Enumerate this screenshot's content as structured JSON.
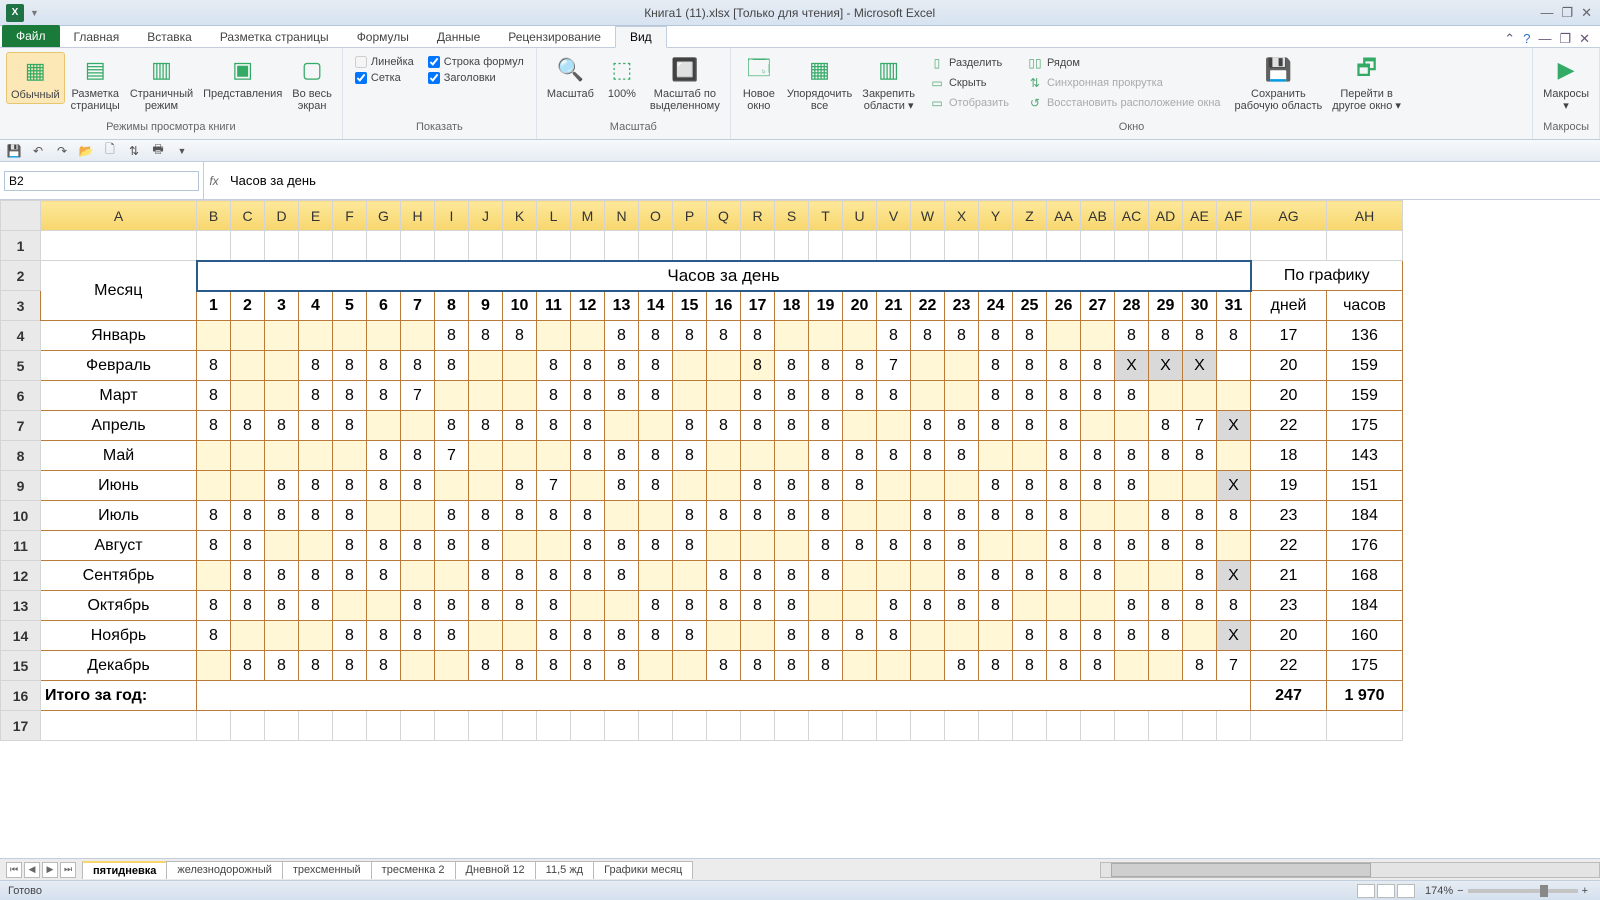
{
  "title": "Книга1 (11).xlsx  [Только для чтения]  -  Microsoft Excel",
  "tabs": {
    "file": "Файл",
    "items": [
      "Главная",
      "Вставка",
      "Разметка страницы",
      "Формулы",
      "Данные",
      "Рецензирование",
      "Вид"
    ],
    "active": "Вид"
  },
  "ribbon": {
    "group_views": {
      "label": "Режимы просмотра книги",
      "normal": "Обычный",
      "page_layout": "Разметка\nстраницы",
      "page_break": "Страничный\nрежим",
      "custom_views": "Представления",
      "full_screen": "Во весь\nэкран"
    },
    "group_show": {
      "label": "Показать",
      "ruler": "Линейка",
      "formula_bar": "Строка формул",
      "gridlines": "Сетка",
      "headings": "Заголовки"
    },
    "group_zoom": {
      "label": "Масштаб",
      "zoom": "Масштаб",
      "z100": "100%",
      "zoom_sel": "Масштаб по\nвыделенному"
    },
    "group_window": {
      "label": "Окно",
      "new_window": "Новое\nокно",
      "arrange": "Упорядочить\nвсе",
      "freeze": "Закрепить\nобласти ▾",
      "split": "Разделить",
      "hide": "Скрыть",
      "unhide": "Отобразить",
      "side": "Рядом",
      "sync": "Синхронная прокрутка",
      "reset": "Восстановить расположение окна",
      "save_ws": "Сохранить\nрабочую область",
      "switch": "Перейти в\nдругое окно ▾"
    },
    "group_macros": {
      "label": "Макросы",
      "macros": "Макросы\n▾"
    }
  },
  "namebox": "B2",
  "formula": "Часов за день",
  "columns": [
    "A",
    "B",
    "C",
    "D",
    "E",
    "F",
    "G",
    "H",
    "I",
    "J",
    "K",
    "L",
    "M",
    "N",
    "O",
    "P",
    "Q",
    "R",
    "S",
    "T",
    "U",
    "V",
    "W",
    "X",
    "Y",
    "Z",
    "AA",
    "AB",
    "AC",
    "AD",
    "AE",
    "AF",
    "AG",
    "AH"
  ],
  "header_row2": {
    "A": "Месяц",
    "merged": "Часов за день",
    "AG_AH": "По графику"
  },
  "header_row3": {
    "days": [
      "1",
      "2",
      "3",
      "4",
      "5",
      "6",
      "7",
      "8",
      "9",
      "10",
      "11",
      "12",
      "13",
      "14",
      "15",
      "16",
      "17",
      "18",
      "19",
      "20",
      "21",
      "22",
      "23",
      "24",
      "25",
      "26",
      "27",
      "28",
      "29",
      "30",
      "31"
    ],
    "AG": "дней",
    "AH": "часов"
  },
  "months": [
    {
      "name": "Январь",
      "d": [
        "",
        "",
        "",
        "",
        "",
        "",
        "",
        "8",
        "8",
        "8",
        "",
        "",
        "8",
        "8",
        "8",
        "8",
        "8",
        "",
        "",
        "",
        "8",
        "8",
        "8",
        "8",
        "8",
        "",
        "",
        "8",
        "8",
        "8",
        "8"
      ],
      "days": "17",
      "hours": "136",
      "yel": [
        1,
        2,
        3,
        4,
        5,
        6,
        7,
        11,
        12,
        18,
        19,
        20,
        26,
        27
      ]
    },
    {
      "name": "Февраль",
      "d": [
        "8",
        "",
        "",
        "8",
        "8",
        "8",
        "8",
        "8",
        "",
        "",
        "8",
        "8",
        "8",
        "8",
        "",
        "",
        "8",
        "8",
        "8",
        "8",
        "7",
        "",
        "",
        "8",
        "8",
        "8",
        "8",
        "X",
        "X",
        "X",
        ""
      ],
      "days": "20",
      "hours": "159",
      "yel": [
        2,
        3,
        9,
        10,
        15,
        16,
        17,
        22,
        23
      ],
      "gra": [
        28,
        29,
        30
      ]
    },
    {
      "name": "Март",
      "d": [
        "8",
        "",
        "",
        "8",
        "8",
        "8",
        "7",
        "",
        "",
        "",
        "8",
        "8",
        "8",
        "8",
        "",
        "",
        "8",
        "8",
        "8",
        "8",
        "8",
        "",
        "",
        "8",
        "8",
        "8",
        "8",
        "8",
        "",
        "",
        ""
      ],
      "days": "20",
      "hours": "159",
      "yel": [
        2,
        3,
        8,
        9,
        10,
        15,
        16,
        22,
        23,
        29,
        30,
        31
      ]
    },
    {
      "name": "Апрель",
      "d": [
        "8",
        "8",
        "8",
        "8",
        "8",
        "",
        "",
        "8",
        "8",
        "8",
        "8",
        "8",
        "",
        "",
        "8",
        "8",
        "8",
        "8",
        "8",
        "",
        "",
        "8",
        "8",
        "8",
        "8",
        "8",
        "",
        "",
        "8",
        "7",
        "X"
      ],
      "days": "22",
      "hours": "175",
      "yel": [
        6,
        7,
        13,
        14,
        20,
        21,
        27,
        28
      ],
      "gra": [
        31
      ]
    },
    {
      "name": "Май",
      "d": [
        "",
        "",
        "",
        "",
        "",
        "8",
        "8",
        "7",
        "",
        "",
        "",
        "8",
        "8",
        "8",
        "8",
        "",
        "",
        "",
        "8",
        "8",
        "8",
        "8",
        "8",
        "",
        "",
        "8",
        "8",
        "8",
        "8",
        "8",
        ""
      ],
      "days": "18",
      "hours": "143",
      "yel": [
        1,
        2,
        3,
        4,
        5,
        9,
        10,
        11,
        16,
        17,
        18,
        24,
        25,
        31
      ]
    },
    {
      "name": "Июнь",
      "d": [
        "",
        "",
        "8",
        "8",
        "8",
        "8",
        "8",
        "",
        "",
        "8",
        "7",
        "",
        "8",
        "8",
        "",
        "",
        "8",
        "8",
        "8",
        "8",
        "",
        "",
        "",
        "8",
        "8",
        "8",
        "8",
        "8",
        "",
        "",
        "X"
      ],
      "days": "19",
      "hours": "151",
      "yel": [
        1,
        2,
        8,
        9,
        12,
        15,
        16,
        21,
        22,
        23,
        29,
        30
      ],
      "gra": [
        31
      ]
    },
    {
      "name": "Июль",
      "d": [
        "8",
        "8",
        "8",
        "8",
        "8",
        "",
        "",
        "8",
        "8",
        "8",
        "8",
        "8",
        "",
        "",
        "8",
        "8",
        "8",
        "8",
        "8",
        "",
        "",
        "8",
        "8",
        "8",
        "8",
        "8",
        "",
        "",
        "8",
        "8",
        "8"
      ],
      "days": "23",
      "hours": "184",
      "yel": [
        6,
        7,
        13,
        14,
        20,
        21,
        27,
        28
      ]
    },
    {
      "name": "Август",
      "d": [
        "8",
        "8",
        "",
        "",
        "8",
        "8",
        "8",
        "8",
        "8",
        "",
        "",
        "8",
        "8",
        "8",
        "8",
        "",
        "",
        "",
        "8",
        "8",
        "8",
        "8",
        "8",
        "",
        "",
        "8",
        "8",
        "8",
        "8",
        "8",
        ""
      ],
      "days": "22",
      "hours": "176",
      "yel": [
        3,
        4,
        10,
        11,
        16,
        17,
        18,
        24,
        25,
        31
      ]
    },
    {
      "name": "Сентябрь",
      "d": [
        "",
        "8",
        "8",
        "8",
        "8",
        "8",
        "",
        "",
        "8",
        "8",
        "8",
        "8",
        "8",
        "",
        "",
        "8",
        "8",
        "8",
        "8",
        "",
        "",
        "",
        "8",
        "8",
        "8",
        "8",
        "8",
        "",
        "",
        "8",
        "X"
      ],
      "days": "21",
      "hours": "168",
      "yel": [
        1,
        7,
        8,
        14,
        15,
        20,
        21,
        22,
        28,
        29
      ],
      "gra": [
        31
      ]
    },
    {
      "name": "Октябрь",
      "d": [
        "8",
        "8",
        "8",
        "8",
        "",
        "",
        "8",
        "8",
        "8",
        "8",
        "8",
        "",
        "",
        "8",
        "8",
        "8",
        "8",
        "8",
        "",
        "",
        "8",
        "8",
        "8",
        "8",
        "",
        "",
        "",
        "8",
        "8",
        "8",
        "8"
      ],
      "days": "23",
      "hours": "184",
      "yel": [
        5,
        6,
        12,
        13,
        19,
        20,
        25,
        26,
        27
      ]
    },
    {
      "name": "Ноябрь",
      "d": [
        "8",
        "",
        "",
        "",
        "8",
        "8",
        "8",
        "8",
        "",
        "",
        "8",
        "8",
        "8",
        "8",
        "8",
        "",
        "",
        "8",
        "8",
        "8",
        "8",
        "",
        "",
        "",
        "8",
        "8",
        "8",
        "8",
        "8",
        "",
        "X"
      ],
      "days": "20",
      "hours": "160",
      "yel": [
        2,
        3,
        4,
        9,
        10,
        16,
        17,
        22,
        23,
        24,
        30
      ],
      "gra": [
        31
      ]
    },
    {
      "name": "Декабрь",
      "d": [
        "",
        "8",
        "8",
        "8",
        "8",
        "8",
        "",
        "",
        "8",
        "8",
        "8",
        "8",
        "8",
        "",
        "",
        "8",
        "8",
        "8",
        "8",
        "",
        "",
        "",
        "8",
        "8",
        "8",
        "8",
        "8",
        "",
        "",
        "8",
        "7"
      ],
      "days": "22",
      "hours": "175",
      "yel": [
        1,
        7,
        8,
        14,
        15,
        20,
        21,
        22,
        28,
        29
      ]
    }
  ],
  "total": {
    "label": "Итого за год:",
    "days": "247",
    "hours": "1 970"
  },
  "sheet_tabs": [
    "пятидневка",
    "железнодорожный",
    "трехсменный",
    "тресменка 2",
    "Дневной 12",
    "11,5 жд",
    "Графики месяц"
  ],
  "sheet_active": "пятидневка",
  "status": {
    "ready": "Готово",
    "zoom": "174%"
  }
}
